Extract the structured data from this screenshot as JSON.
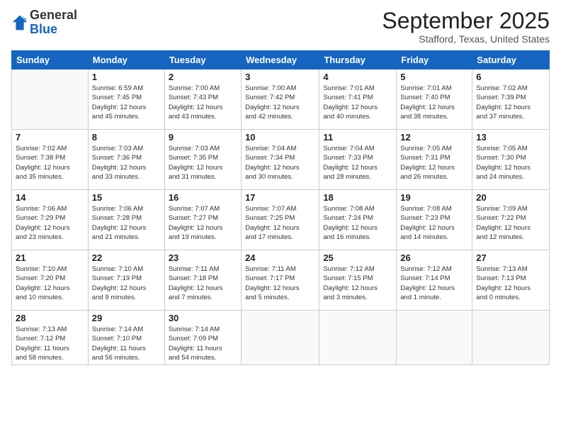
{
  "header": {
    "logo_general": "General",
    "logo_blue": "Blue",
    "month_title": "September 2025",
    "location": "Stafford, Texas, United States"
  },
  "days_of_week": [
    "Sunday",
    "Monday",
    "Tuesday",
    "Wednesday",
    "Thursday",
    "Friday",
    "Saturday"
  ],
  "weeks": [
    [
      {
        "day": "",
        "info": ""
      },
      {
        "day": "1",
        "info": "Sunrise: 6:59 AM\nSunset: 7:45 PM\nDaylight: 12 hours\nand 45 minutes."
      },
      {
        "day": "2",
        "info": "Sunrise: 7:00 AM\nSunset: 7:43 PM\nDaylight: 12 hours\nand 43 minutes."
      },
      {
        "day": "3",
        "info": "Sunrise: 7:00 AM\nSunset: 7:42 PM\nDaylight: 12 hours\nand 42 minutes."
      },
      {
        "day": "4",
        "info": "Sunrise: 7:01 AM\nSunset: 7:41 PM\nDaylight: 12 hours\nand 40 minutes."
      },
      {
        "day": "5",
        "info": "Sunrise: 7:01 AM\nSunset: 7:40 PM\nDaylight: 12 hours\nand 38 minutes."
      },
      {
        "day": "6",
        "info": "Sunrise: 7:02 AM\nSunset: 7:39 PM\nDaylight: 12 hours\nand 37 minutes."
      }
    ],
    [
      {
        "day": "7",
        "info": "Sunrise: 7:02 AM\nSunset: 7:38 PM\nDaylight: 12 hours\nand 35 minutes."
      },
      {
        "day": "8",
        "info": "Sunrise: 7:03 AM\nSunset: 7:36 PM\nDaylight: 12 hours\nand 33 minutes."
      },
      {
        "day": "9",
        "info": "Sunrise: 7:03 AM\nSunset: 7:35 PM\nDaylight: 12 hours\nand 31 minutes."
      },
      {
        "day": "10",
        "info": "Sunrise: 7:04 AM\nSunset: 7:34 PM\nDaylight: 12 hours\nand 30 minutes."
      },
      {
        "day": "11",
        "info": "Sunrise: 7:04 AM\nSunset: 7:33 PM\nDaylight: 12 hours\nand 28 minutes."
      },
      {
        "day": "12",
        "info": "Sunrise: 7:05 AM\nSunset: 7:31 PM\nDaylight: 12 hours\nand 26 minutes."
      },
      {
        "day": "13",
        "info": "Sunrise: 7:05 AM\nSunset: 7:30 PM\nDaylight: 12 hours\nand 24 minutes."
      }
    ],
    [
      {
        "day": "14",
        "info": "Sunrise: 7:06 AM\nSunset: 7:29 PM\nDaylight: 12 hours\nand 23 minutes."
      },
      {
        "day": "15",
        "info": "Sunrise: 7:06 AM\nSunset: 7:28 PM\nDaylight: 12 hours\nand 21 minutes."
      },
      {
        "day": "16",
        "info": "Sunrise: 7:07 AM\nSunset: 7:27 PM\nDaylight: 12 hours\nand 19 minutes."
      },
      {
        "day": "17",
        "info": "Sunrise: 7:07 AM\nSunset: 7:25 PM\nDaylight: 12 hours\nand 17 minutes."
      },
      {
        "day": "18",
        "info": "Sunrise: 7:08 AM\nSunset: 7:24 PM\nDaylight: 12 hours\nand 16 minutes."
      },
      {
        "day": "19",
        "info": "Sunrise: 7:08 AM\nSunset: 7:23 PM\nDaylight: 12 hours\nand 14 minutes."
      },
      {
        "day": "20",
        "info": "Sunrise: 7:09 AM\nSunset: 7:22 PM\nDaylight: 12 hours\nand 12 minutes."
      }
    ],
    [
      {
        "day": "21",
        "info": "Sunrise: 7:10 AM\nSunset: 7:20 PM\nDaylight: 12 hours\nand 10 minutes."
      },
      {
        "day": "22",
        "info": "Sunrise: 7:10 AM\nSunset: 7:19 PM\nDaylight: 12 hours\nand 9 minutes."
      },
      {
        "day": "23",
        "info": "Sunrise: 7:11 AM\nSunset: 7:18 PM\nDaylight: 12 hours\nand 7 minutes."
      },
      {
        "day": "24",
        "info": "Sunrise: 7:11 AM\nSunset: 7:17 PM\nDaylight: 12 hours\nand 5 minutes."
      },
      {
        "day": "25",
        "info": "Sunrise: 7:12 AM\nSunset: 7:15 PM\nDaylight: 12 hours\nand 3 minutes."
      },
      {
        "day": "26",
        "info": "Sunrise: 7:12 AM\nSunset: 7:14 PM\nDaylight: 12 hours\nand 1 minute."
      },
      {
        "day": "27",
        "info": "Sunrise: 7:13 AM\nSunset: 7:13 PM\nDaylight: 12 hours\nand 0 minutes."
      }
    ],
    [
      {
        "day": "28",
        "info": "Sunrise: 7:13 AM\nSunset: 7:12 PM\nDaylight: 11 hours\nand 58 minutes."
      },
      {
        "day": "29",
        "info": "Sunrise: 7:14 AM\nSunset: 7:10 PM\nDaylight: 11 hours\nand 56 minutes."
      },
      {
        "day": "30",
        "info": "Sunrise: 7:14 AM\nSunset: 7:09 PM\nDaylight: 11 hours\nand 54 minutes."
      },
      {
        "day": "",
        "info": ""
      },
      {
        "day": "",
        "info": ""
      },
      {
        "day": "",
        "info": ""
      },
      {
        "day": "",
        "info": ""
      }
    ]
  ]
}
